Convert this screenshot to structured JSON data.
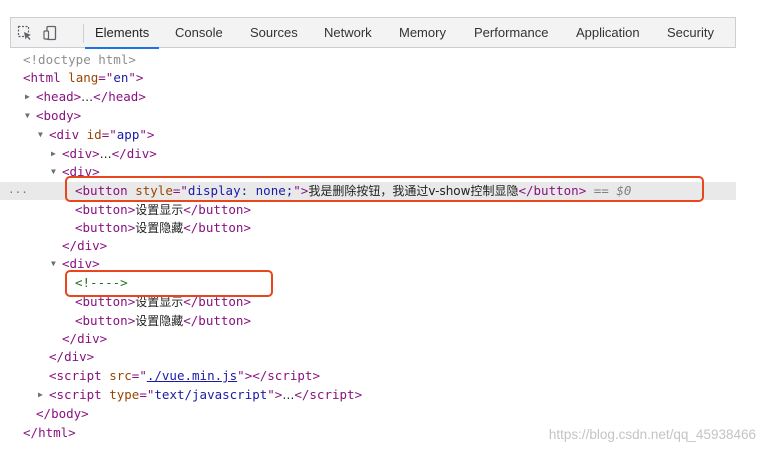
{
  "toolbar": {
    "tabs": [
      {
        "label": "Elements",
        "active": true
      },
      {
        "label": "Console"
      },
      {
        "label": "Sources"
      },
      {
        "label": "Network"
      },
      {
        "label": "Memory"
      },
      {
        "label": "Performance"
      },
      {
        "label": "Application"
      },
      {
        "label": "Security"
      }
    ],
    "icons": [
      "inspect-element-icon",
      "device-toolbar-icon"
    ]
  },
  "dom_tree": {
    "doctype": "<!doctype html>",
    "html_tag": "html",
    "html_attr": "lang",
    "html_lang": "en",
    "head_tag": "head",
    "body_tag": "body",
    "div_tag": "div",
    "div_id_attr": "id",
    "div_id": "app",
    "button_tag": "button",
    "style_attr": "style",
    "style_value": "display: none;",
    "button_hidden_text": "我是删除按钮，我通过v-show控制显隐",
    "dollar_ref": "== $0",
    "button_show_text": "设置显示",
    "button_hide_text": "设置隐藏",
    "comment": "<!---->",
    "script_tag": "script",
    "src_attr": "src",
    "script_src": "./vue.min.js",
    "type_attr": "type",
    "script_type": "text/javascript",
    "ellipsis": "…",
    "selected_row_marker": "..."
  },
  "watermark": "https://blog.csdn.net/qq_45938466",
  "colors": {
    "highlight_box": "#e8461c",
    "active_tab_underline": "#1a73e8",
    "tag": "#881280",
    "attribute": "#994500",
    "value": "#1a1aa6"
  }
}
